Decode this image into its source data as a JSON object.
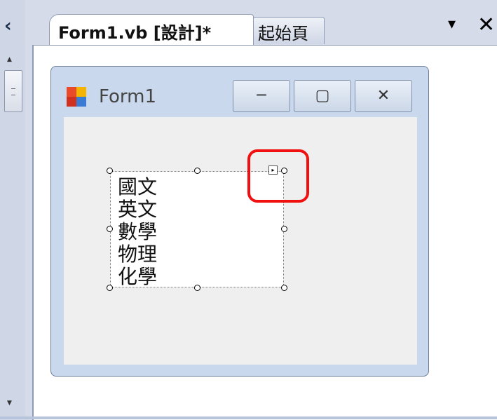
{
  "tabs": {
    "active_label": "Form1.vb [設計]*",
    "inactive_label": "起始頁",
    "dropdown_icon": "▾",
    "close_icon": "✕"
  },
  "form": {
    "title": "Form1",
    "minimize_icon": "─",
    "maximize_icon": "▢",
    "close_icon": "✕"
  },
  "listbox": {
    "items": [
      "國文",
      "英文",
      "數學",
      "物理",
      "化學"
    ]
  },
  "colors": {
    "highlight": "#f01010",
    "form_border": "#6c7d97"
  }
}
